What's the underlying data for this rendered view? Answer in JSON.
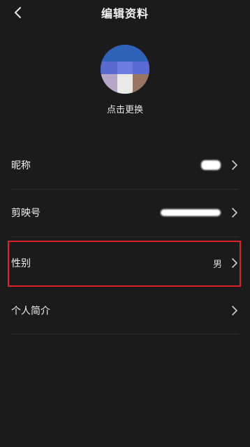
{
  "header": {
    "title": "编辑资料"
  },
  "avatar": {
    "change_label": "点击更换"
  },
  "rows": [
    {
      "label": "昵称",
      "value": ""
    },
    {
      "label": "剪映号",
      "value": ""
    },
    {
      "label": "性别",
      "value": "男"
    },
    {
      "label": "个人简介",
      "value": ""
    }
  ],
  "colors": {
    "background": "#1b1b1b",
    "highlight": "#e0242e",
    "text": "#ececec"
  }
}
